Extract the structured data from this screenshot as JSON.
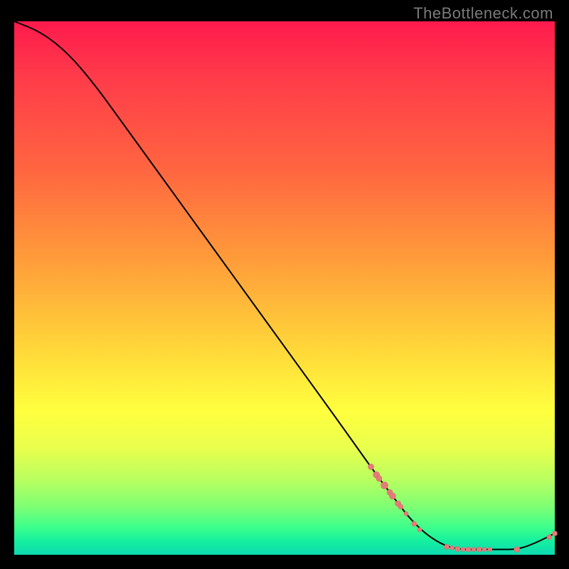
{
  "watermark": "TheBottleneck.com",
  "colors": {
    "background": "#000000",
    "curve": "#000000",
    "marker_fill": "#e67a7a",
    "marker_stroke": "#d96969"
  },
  "chart_data": {
    "type": "line",
    "title": "",
    "xlabel": "",
    "ylabel": "",
    "xlim": [
      0,
      100
    ],
    "ylim": [
      0,
      100
    ],
    "curve": [
      {
        "x": 0,
        "y": 100
      },
      {
        "x": 5,
        "y": 98
      },
      {
        "x": 10,
        "y": 94
      },
      {
        "x": 15,
        "y": 88
      },
      {
        "x": 20,
        "y": 81
      },
      {
        "x": 30,
        "y": 67
      },
      {
        "x": 40,
        "y": 53
      },
      {
        "x": 50,
        "y": 39
      },
      {
        "x": 60,
        "y": 25
      },
      {
        "x": 67,
        "y": 15
      },
      {
        "x": 70,
        "y": 11
      },
      {
        "x": 73,
        "y": 7
      },
      {
        "x": 76,
        "y": 4
      },
      {
        "x": 79,
        "y": 2
      },
      {
        "x": 82,
        "y": 1
      },
      {
        "x": 86,
        "y": 1
      },
      {
        "x": 90,
        "y": 1
      },
      {
        "x": 93,
        "y": 1
      },
      {
        "x": 96,
        "y": 2
      },
      {
        "x": 100,
        "y": 4
      }
    ],
    "markers": [
      {
        "x": 66,
        "y": 16.5,
        "r": 4
      },
      {
        "x": 67,
        "y": 15.0,
        "r": 4.5
      },
      {
        "x": 67.5,
        "y": 14.3,
        "r": 4
      },
      {
        "x": 68.5,
        "y": 13.0,
        "r": 5
      },
      {
        "x": 69.5,
        "y": 11.7,
        "r": 4
      },
      {
        "x": 70,
        "y": 11.0,
        "r": 4.5
      },
      {
        "x": 71,
        "y": 9.6,
        "r": 4
      },
      {
        "x": 71.5,
        "y": 9.0,
        "r": 3.5
      },
      {
        "x": 72.5,
        "y": 7.7,
        "r": 3
      },
      {
        "x": 74.0,
        "y": 5.8,
        "r": 3.5
      },
      {
        "x": 75.0,
        "y": 4.7,
        "r": 3
      },
      {
        "x": 80.0,
        "y": 1.5,
        "r": 3.5
      },
      {
        "x": 81.0,
        "y": 1.3,
        "r": 3
      },
      {
        "x": 82.0,
        "y": 1.1,
        "r": 3.5
      },
      {
        "x": 83.0,
        "y": 1.0,
        "r": 3
      },
      {
        "x": 84.0,
        "y": 1.0,
        "r": 3.5
      },
      {
        "x": 85.0,
        "y": 1.0,
        "r": 3
      },
      {
        "x": 86.0,
        "y": 1.0,
        "r": 3.5
      },
      {
        "x": 87.0,
        "y": 1.0,
        "r": 3
      },
      {
        "x": 88.0,
        "y": 1.0,
        "r": 3
      },
      {
        "x": 93.0,
        "y": 1.0,
        "r": 4
      },
      {
        "x": 99.0,
        "y": 3.3,
        "r": 3.5
      },
      {
        "x": 100.0,
        "y": 4.0,
        "r": 3.5
      }
    ]
  }
}
